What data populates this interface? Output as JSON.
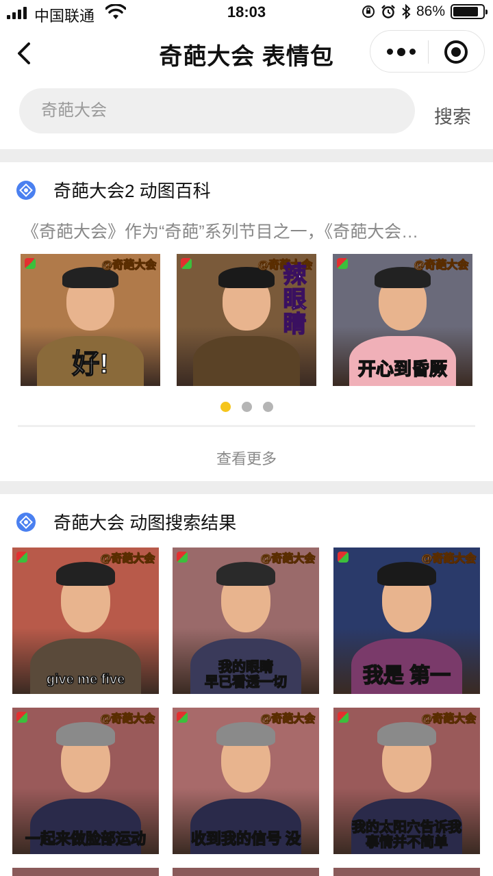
{
  "status": {
    "carrier": "中国联通",
    "time": "18:03",
    "battery": "86%",
    "battery_level": 0.86
  },
  "nav": {
    "title": "奇葩大会 表情包"
  },
  "search": {
    "placeholder": "奇葩大会",
    "button": "搜索"
  },
  "encyclopedia": {
    "title": "奇葩大会2 动图百科",
    "description": "《奇葩大会》作为“奇葩”系列节目之一，《奇葩大会…",
    "more": "查看更多",
    "page_count": 3,
    "active_page": 1,
    "items": [
      {
        "watermark": "@奇葩大会",
        "caption": "好!",
        "bg": "#b07a4a",
        "body": "#8a6a3a",
        "hair": "#222"
      },
      {
        "watermark": "@奇葩大会",
        "caption": "辣眼睛",
        "bg": "#7a5a3a",
        "body": "#5a4226",
        "hair": "#1a1a1a"
      },
      {
        "watermark": "@奇葩大会",
        "caption": "开心到昏厥",
        "bg": "#6a6a7a",
        "body": "#f0b0b8",
        "hair": "#222"
      }
    ]
  },
  "results": {
    "title": "奇葩大会 动图搜索结果",
    "items": [
      {
        "watermark": "@奇葩大会",
        "caption": "give me five",
        "bg": "#b85a4a",
        "body": "#5a4a3a",
        "hair": "#222"
      },
      {
        "watermark": "@奇葩大会",
        "caption": "我的眼睛\n早已看透一切",
        "bg": "#9a6a6a",
        "body": "#3a3a5a",
        "hair": "#2a2a2a"
      },
      {
        "watermark": "@奇葩大会",
        "caption": "我是 第一",
        "bg": "#2a3a6a",
        "body": "#7a3a6a",
        "hair": "#1a1a1a"
      },
      {
        "watermark": "@奇葩大会",
        "caption": "一起来做脸部运动",
        "bg": "#9a5a5a",
        "body": "#2a2a4a",
        "hair": "#8a8a8a"
      },
      {
        "watermark": "@奇葩大会",
        "caption": "收到我的信号 没",
        "bg": "#a86a6a",
        "body": "#2a2a4a",
        "hair": "#8a8a8a"
      },
      {
        "watermark": "@奇葩大会",
        "caption": "我的太阳穴告诉我\n事情并不简单",
        "bg": "#9a5a5a",
        "body": "#2a2a4a",
        "hair": "#8a8a8a"
      }
    ]
  },
  "colors": {
    "accent": "#f5c51c",
    "logo": "#4a80f0",
    "caption_text": "#ffffff"
  }
}
